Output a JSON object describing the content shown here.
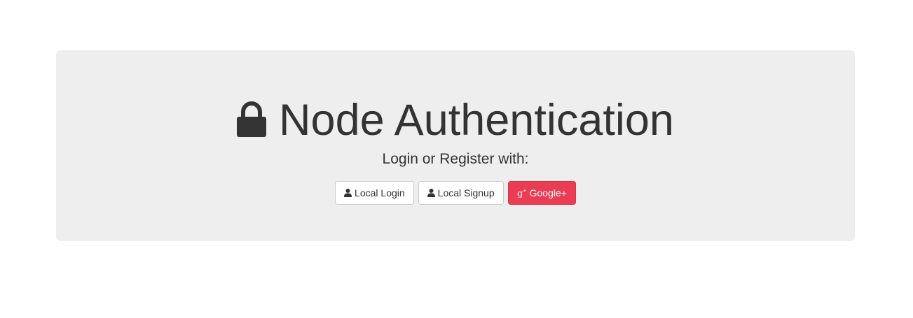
{
  "header": {
    "title": "Node Authentication",
    "title_icon": "lock-icon",
    "subtitle": "Login or Register with:"
  },
  "buttons": {
    "local_login": {
      "label": "Local Login",
      "icon": "user-icon"
    },
    "local_signup": {
      "label": "Local Signup",
      "icon": "user-icon"
    },
    "google": {
      "label": "Google+",
      "icon": "google-plus-icon"
    }
  },
  "colors": {
    "jumbotron_bg": "#eeeeee",
    "text": "#333333",
    "google_button": "#ea3c53"
  }
}
